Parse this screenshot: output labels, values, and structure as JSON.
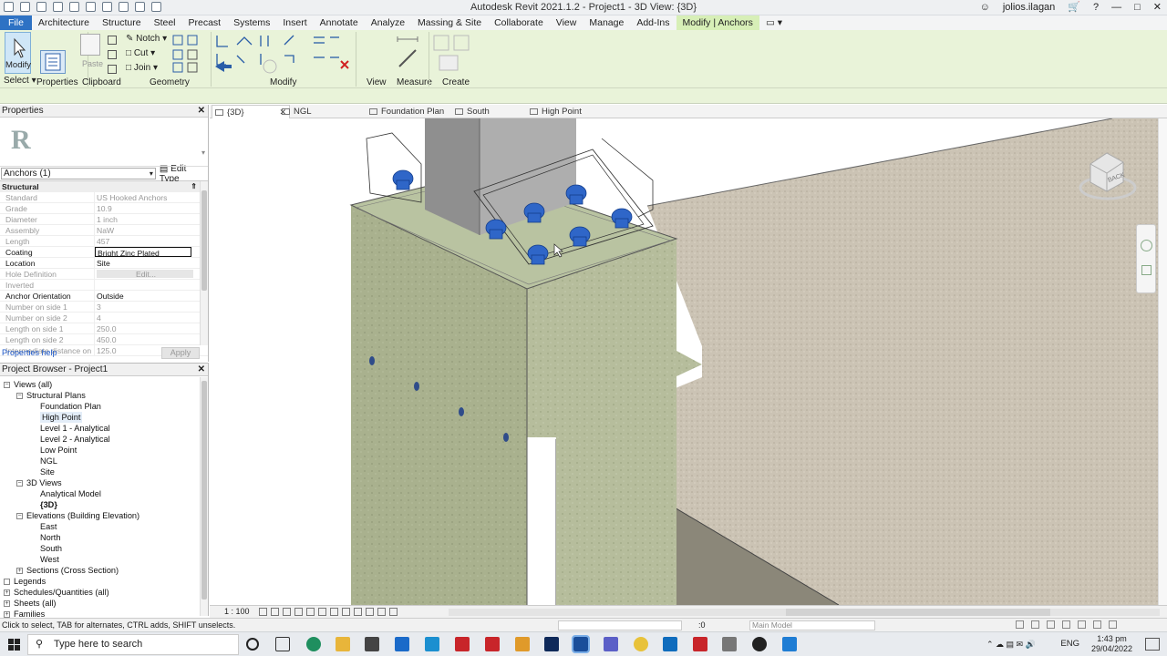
{
  "app": {
    "title": "Autodesk Revit 2021.1.2 - Project1 - 3D View: {3D}",
    "user": "jolios.ilagan"
  },
  "menu": [
    "File",
    "Architecture",
    "Structure",
    "Steel",
    "Precast",
    "Systems",
    "Insert",
    "Annotate",
    "Analyze",
    "Massing & Site",
    "Collaborate",
    "View",
    "Manage",
    "Add-Ins",
    "Modify | Anchors"
  ],
  "ribbon": {
    "modify_label": "Modify",
    "select_label": "Select",
    "properties_label": "Properties",
    "paste_label": "Paste",
    "clipboard_label": "Clipboard",
    "notch_label": "Notch",
    "cut_label": "Cut",
    "join_label": "Join",
    "geometry_label": "Geometry",
    "modify_panel_label": "Modify",
    "view_label": "View",
    "measure_label": "Measure",
    "create_label": "Create"
  },
  "properties": {
    "header": "Properties",
    "instance": "Anchors (1)",
    "edit_type": "Edit Type",
    "category": "Structural",
    "rows": [
      {
        "name": "Standard",
        "value": "US Hooked Anchors",
        "enabled": false
      },
      {
        "name": "Grade",
        "value": "10.9",
        "enabled": false
      },
      {
        "name": "Diameter",
        "value": "1 inch",
        "enabled": false
      },
      {
        "name": "Assembly",
        "value": "NaW",
        "enabled": false
      },
      {
        "name": "Length",
        "value": "457",
        "enabled": false
      },
      {
        "name": "Coating",
        "value": "Bright Zinc Plated",
        "enabled": true,
        "boxed": true
      },
      {
        "name": "Location",
        "value": "Site",
        "enabled": true
      },
      {
        "name": "Hole Definition",
        "value": "Edit...",
        "enabled": false
      },
      {
        "name": "Inverted",
        "value": "",
        "enabled": false
      },
      {
        "name": "Anchor Orientation",
        "value": "Outside",
        "enabled": true
      },
      {
        "name": "Number on side 1",
        "value": "3",
        "enabled": false
      },
      {
        "name": "Number on side 2",
        "value": "4",
        "enabled": false
      },
      {
        "name": "Length on side 1",
        "value": "250.0",
        "enabled": false
      },
      {
        "name": "Length on side 2",
        "value": "450.0",
        "enabled": false
      },
      {
        "name": "Intermediate distance on ...",
        "value": "125.0",
        "enabled": false
      }
    ],
    "help": "Properties help",
    "apply": "Apply"
  },
  "browser": {
    "header": "Project Browser - Project1",
    "items": [
      {
        "label": "Views (all)",
        "level": 0,
        "toggle": "−"
      },
      {
        "label": "Structural Plans",
        "level": 1,
        "toggle": "−"
      },
      {
        "label": "Foundation Plan",
        "level": 2
      },
      {
        "label": "High Point",
        "level": 2,
        "selected": true
      },
      {
        "label": "Level 1 - Analytical",
        "level": 2
      },
      {
        "label": "Level 2 - Analytical",
        "level": 2
      },
      {
        "label": "Low Point",
        "level": 2
      },
      {
        "label": "NGL",
        "level": 2
      },
      {
        "label": "Site",
        "level": 2
      },
      {
        "label": "3D Views",
        "level": 1,
        "toggle": "−"
      },
      {
        "label": "Analytical Model",
        "level": 2
      },
      {
        "label": "{3D}",
        "level": 2,
        "bold": true
      },
      {
        "label": "Elevations (Building Elevation)",
        "level": 1,
        "toggle": "−"
      },
      {
        "label": "East",
        "level": 2
      },
      {
        "label": "North",
        "level": 2
      },
      {
        "label": "South",
        "level": 2
      },
      {
        "label": "West",
        "level": 2
      },
      {
        "label": "Sections (Cross Section)",
        "level": 1,
        "toggle": "+"
      },
      {
        "label": "Legends",
        "level": 0,
        "toggle": ""
      },
      {
        "label": "Schedules/Quantities (all)",
        "level": 0,
        "toggle": "+"
      },
      {
        "label": "Sheets (all)",
        "level": 0,
        "toggle": "+"
      },
      {
        "label": "Families",
        "level": 0,
        "toggle": "+"
      }
    ]
  },
  "view_tabs": [
    "{3D}",
    "NGL",
    "Foundation Plan",
    "South",
    "High Point"
  ],
  "viewcube_label": "BACK",
  "view_scale": "1 : 100",
  "status": {
    "text": "Click to select, TAB for alternates, CTRL adds, SHIFT unselects.",
    "selection_count": ":0",
    "model": "Main Model"
  },
  "taskbar": {
    "search": "Type here to search",
    "lang": "ENG",
    "time": "1:43 pm",
    "date": "29/04/2022"
  },
  "colors": {
    "file_tab": "#2e72c4",
    "ribbon_bg": "#e9f3d9",
    "anchor_blue": "#2f66c8",
    "concrete": "#a7af8c",
    "ground": "#c9c0b0"
  }
}
